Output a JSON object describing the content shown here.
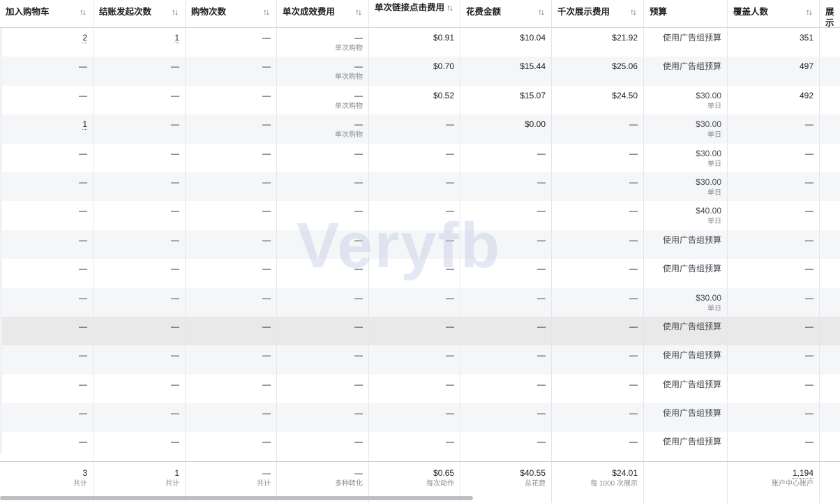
{
  "headers": [
    {
      "label": "加入购物车",
      "sortable": true
    },
    {
      "label": "结账发起次数",
      "sortable": true
    },
    {
      "label": "购物次数",
      "sortable": true
    },
    {
      "label": "单次成效费用",
      "sortable": true
    },
    {
      "label": "单次链接点击费用",
      "sortable": true
    },
    {
      "label": "花费金额",
      "sortable": true
    },
    {
      "label": "千次展示费用",
      "sortable": true
    },
    {
      "label": "预算",
      "sortable": false
    },
    {
      "label": "覆盖人数",
      "sortable": true
    },
    {
      "label": "展示",
      "sortable": false
    }
  ],
  "sort_glyph": "↑↓",
  "rows": [
    {
      "cart": "2",
      "checkout": "1",
      "purchases": "—",
      "cpr": "—",
      "cpr_sub": "单次购物",
      "cpc": "$0.91",
      "spend": "$10.04",
      "cpm": "$21.92",
      "budget": "使用广告组预算",
      "budget_sub": "",
      "reach": "351"
    },
    {
      "cart": "—",
      "checkout": "—",
      "purchases": "—",
      "cpr": "—",
      "cpr_sub": "单次购物",
      "cpc": "$0.70",
      "spend": "$15.44",
      "cpm": "$25.06",
      "budget": "使用广告组预算",
      "budget_sub": "",
      "reach": "497"
    },
    {
      "cart": "—",
      "checkout": "—",
      "purchases": "—",
      "cpr": "—",
      "cpr_sub": "单次购物",
      "cpc": "$0.52",
      "spend": "$15.07",
      "cpm": "$24.50",
      "budget": "$30.00",
      "budget_sub": "单日",
      "reach": "492"
    },
    {
      "cart": "1",
      "checkout": "—",
      "purchases": "—",
      "cpr": "—",
      "cpr_sub": "单次购物",
      "cpc": "—",
      "spend": "$0.00",
      "cpm": "—",
      "budget": "$30.00",
      "budget_sub": "单日",
      "reach": "—"
    },
    {
      "cart": "—",
      "checkout": "—",
      "purchases": "—",
      "cpr": "—",
      "cpr_sub": "",
      "cpc": "—",
      "spend": "—",
      "cpm": "—",
      "budget": "$30.00",
      "budget_sub": "单日",
      "reach": "—"
    },
    {
      "cart": "—",
      "checkout": "—",
      "purchases": "—",
      "cpr": "—",
      "cpr_sub": "",
      "cpc": "—",
      "spend": "—",
      "cpm": "—",
      "budget": "$30.00",
      "budget_sub": "单日",
      "reach": "—"
    },
    {
      "cart": "—",
      "checkout": "—",
      "purchases": "—",
      "cpr": "—",
      "cpr_sub": "",
      "cpc": "—",
      "spend": "—",
      "cpm": "—",
      "budget": "$40.00",
      "budget_sub": "单日",
      "reach": "—"
    },
    {
      "cart": "—",
      "checkout": "—",
      "purchases": "—",
      "cpr": "—",
      "cpr_sub": "",
      "cpc": "—",
      "spend": "—",
      "cpm": "—",
      "budget": "使用广告组预算",
      "budget_sub": "",
      "reach": "—"
    },
    {
      "cart": "—",
      "checkout": "—",
      "purchases": "—",
      "cpr": "—",
      "cpr_sub": "",
      "cpc": "—",
      "spend": "—",
      "cpm": "—",
      "budget": "使用广告组预算",
      "budget_sub": "",
      "reach": "—"
    },
    {
      "cart": "—",
      "checkout": "—",
      "purchases": "—",
      "cpr": "—",
      "cpr_sub": "",
      "cpc": "—",
      "spend": "—",
      "cpm": "—",
      "budget": "$30.00",
      "budget_sub": "单日",
      "reach": "—"
    },
    {
      "cart": "—",
      "checkout": "—",
      "purchases": "—",
      "cpr": "—",
      "cpr_sub": "",
      "cpc": "—",
      "spend": "—",
      "cpm": "—",
      "budget": "使用广告组预算",
      "budget_sub": "",
      "reach": "—"
    },
    {
      "cart": "—",
      "checkout": "—",
      "purchases": "—",
      "cpr": "—",
      "cpr_sub": "",
      "cpc": "—",
      "spend": "—",
      "cpm": "—",
      "budget": "使用广告组预算",
      "budget_sub": "",
      "reach": "—"
    },
    {
      "cart": "—",
      "checkout": "—",
      "purchases": "—",
      "cpr": "—",
      "cpr_sub": "",
      "cpc": "—",
      "spend": "—",
      "cpm": "—",
      "budget": "使用广告组预算",
      "budget_sub": "",
      "reach": "—"
    },
    {
      "cart": "—",
      "checkout": "—",
      "purchases": "—",
      "cpr": "—",
      "cpr_sub": "",
      "cpc": "—",
      "spend": "—",
      "cpm": "—",
      "budget": "使用广告组预算",
      "budget_sub": "",
      "reach": "—"
    },
    {
      "cart": "—",
      "checkout": "—",
      "purchases": "—",
      "cpr": "—",
      "cpr_sub": "",
      "cpc": "—",
      "spend": "—",
      "cpm": "—",
      "budget": "使用广告组预算",
      "budget_sub": "",
      "reach": "—"
    }
  ],
  "highlighted_row": 10,
  "footer": {
    "cart": {
      "value": "3",
      "sub": "共计"
    },
    "checkout": {
      "value": "1",
      "sub": "共计"
    },
    "purchases": {
      "value": "—",
      "sub": "共计"
    },
    "cpr": {
      "value": "—",
      "sub": "多种转化"
    },
    "cpc": {
      "value": "$0.65",
      "sub": "每次动作"
    },
    "spend": {
      "value": "$40.55",
      "sub": "总花费"
    },
    "cpm": {
      "value": "$24.01",
      "sub": "每 1000 次展示"
    },
    "budget": {
      "value": "",
      "sub": ""
    },
    "reach": {
      "value": "1,194",
      "sub": "账户中心账户"
    }
  },
  "watermark": "Veryfb",
  "colors": {
    "header_border": "#d0d3d8",
    "alt_row": "#f5f6f7",
    "highlight_row": "#e9e9e9",
    "sub_text": "#8a8d91"
  }
}
